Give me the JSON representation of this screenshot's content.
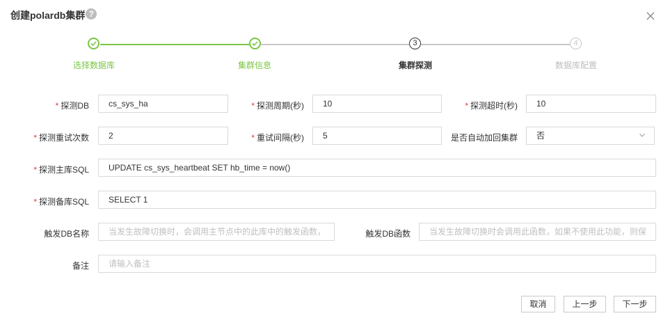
{
  "dialog": {
    "title": "创建polardb集群",
    "help_icon": "?"
  },
  "steps": [
    {
      "label": "选择数据库",
      "state": "done",
      "marker": ""
    },
    {
      "label": "集群信息",
      "state": "done",
      "marker": ""
    },
    {
      "label": "集群探测",
      "state": "active",
      "marker": "3"
    },
    {
      "label": "数据库配置",
      "state": "todo",
      "marker": "4"
    }
  ],
  "colors": {
    "accent": "#7cc545",
    "required": "#e4393c",
    "border": "#d9d9d9"
  },
  "form": {
    "probe_db": {
      "label": "探测DB",
      "value": "cs_sys_ha"
    },
    "probe_period": {
      "label": "探测周期(秒)",
      "value": "10"
    },
    "probe_timeout": {
      "label": "探测超时(秒)",
      "value": "10"
    },
    "probe_retries": {
      "label": "探测重试次数",
      "value": "2"
    },
    "retry_interval": {
      "label": "重试间隔(秒)",
      "value": "5"
    },
    "auto_rejoin": {
      "label": "是否自动加回集群",
      "value": "否"
    },
    "primary_sql": {
      "label": "探测主库SQL",
      "value": "UPDATE cs_sys_heartbeat SET hb_time = now()"
    },
    "standby_sql": {
      "label": "探测备库SQL",
      "value": "SELECT 1"
    },
    "trigger_db": {
      "label": "触发DB名称",
      "placeholder": "当发生故障切换时，会调用主节点中的此库中的触发函数，"
    },
    "trigger_func": {
      "label": "触发DB函数",
      "placeholder": "当发生故障切换时会调用此函数，如果不使用此功能，则保"
    },
    "remark": {
      "label": "备注",
      "placeholder": "请输入备注"
    }
  },
  "buttons": {
    "cancel": "取消",
    "prev": "上一步",
    "next": "下一步"
  }
}
